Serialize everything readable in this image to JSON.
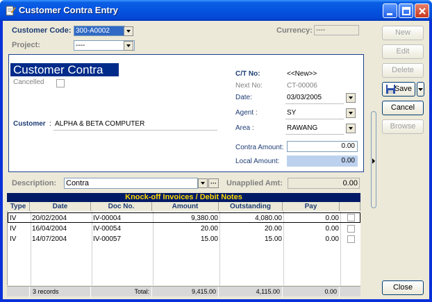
{
  "window": {
    "title": "Customer Contra Entry"
  },
  "header": {
    "customer_code_label": "Customer Code:",
    "customer_code_value": "300-A0002",
    "project_label": "Project:",
    "project_value": "----",
    "currency_label": "Currency:",
    "currency_value": "----"
  },
  "doc": {
    "banner": "Customer Contra",
    "cancelled_label": "Cancelled",
    "customer_label": "Customer",
    "customer_sep": ":",
    "customer_name": "ALPHA & BETA COMPUTER",
    "ct_no_label": "C/T No:",
    "ct_no_value": "<<New>>",
    "next_no_label": "Next No:",
    "next_no_value": "CT-00006",
    "date_label": "Date:",
    "date_value": "03/03/2005",
    "agent_label": "Agent :",
    "agent_value": "SY",
    "area_label": "Area :",
    "area_value": "RAWANG",
    "contra_amount_label": "Contra Amount:",
    "contra_amount_value": "0.00",
    "local_amount_label": "Local Amount:",
    "local_amount_value": "0.00"
  },
  "description": {
    "label": "Description:",
    "value": "Contra",
    "ellipsis": "···",
    "unapplied_label": "Unapplied Amt:",
    "unapplied_value": "0.00"
  },
  "grid": {
    "title": "Knock-off Invoices / Debit Notes",
    "columns": [
      "Type",
      "Date",
      "Doc No.",
      "Amount",
      "Outstanding",
      "Pay",
      ""
    ],
    "rows": [
      {
        "type": "IV",
        "date": "20/02/2004",
        "doc_no": "IV-00004",
        "amount": "9,380.00",
        "outstanding": "4,080.00",
        "pay": "0.00"
      },
      {
        "type": "IV",
        "date": "16/04/2004",
        "doc_no": "IV-00054",
        "amount": "20.00",
        "outstanding": "20.00",
        "pay": "0.00"
      },
      {
        "type": "IV",
        "date": "14/07/2004",
        "doc_no": "IV-00057",
        "amount": "15.00",
        "outstanding": "15.00",
        "pay": "0.00"
      }
    ],
    "footer": {
      "records": "3 records",
      "total_label": "Total:",
      "amount_total": "9,415.00",
      "outstanding_total": "4,115.00",
      "pay_total": "0.00"
    }
  },
  "buttons": {
    "new": "New",
    "edit": "Edit",
    "delete": "Delete",
    "save": "Save",
    "cancel": "Cancel",
    "browse": "Browse",
    "close": "Close"
  },
  "icons": {
    "app": "edit-document-icon",
    "save": "floppy-disk-icon"
  },
  "colors": {
    "title_bar": "#0554e0",
    "banner": "#002b8a",
    "grid_title_bg": "#001a66",
    "grid_title_text": "#ffd800",
    "local_amount_bg": "#bcd1ee"
  }
}
